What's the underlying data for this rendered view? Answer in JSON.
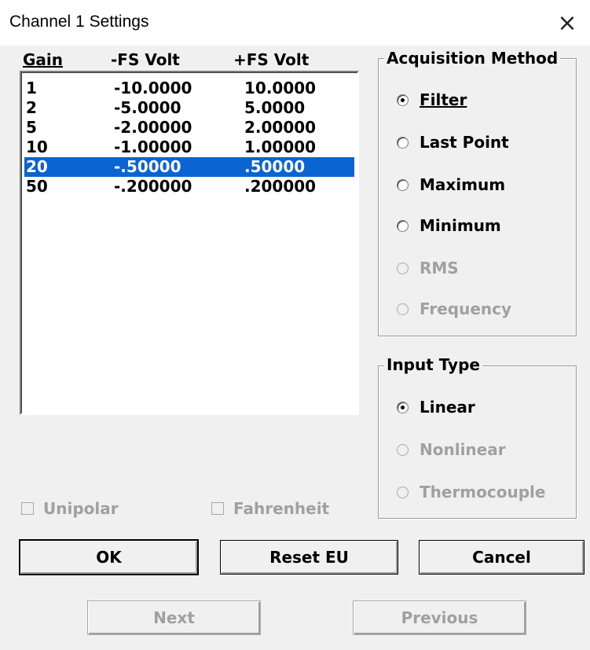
{
  "window": {
    "title": "Channel 1 Settings",
    "close": "×"
  },
  "list": {
    "headers": [
      "Gain",
      "-FS Volt",
      "+FS Volt"
    ],
    "rows": [
      [
        "1",
        "-10.0000",
        "10.0000"
      ],
      [
        "2",
        "-5.0000",
        "5.0000"
      ],
      [
        "5",
        "-2.00000",
        "2.00000"
      ],
      [
        "10",
        "-1.00000",
        "1.00000"
      ],
      [
        "20",
        "-.50000",
        ".50000"
      ],
      [
        "50",
        "-.200000",
        ".200000"
      ]
    ],
    "selected_index": 4
  },
  "acquisition": {
    "label": "Acquisition Method",
    "options": [
      "Filter",
      "Last Point",
      "Maximum",
      "Minimum",
      "RMS",
      "Frequency"
    ],
    "selected": "Filter",
    "disabled": [
      "RMS",
      "Frequency"
    ]
  },
  "input_type": {
    "label": "Input Type",
    "options": [
      "Linear",
      "Nonlinear",
      "Thermocouple"
    ],
    "selected": "Linear",
    "disabled": [
      "Nonlinear",
      "Thermocouple"
    ]
  },
  "checks": {
    "unipolar": "Unipolar",
    "fahrenheit": "Fahrenheit"
  },
  "buttons": {
    "ok": "OK",
    "reset": "Reset EU",
    "cancel": "Cancel",
    "next": "Next",
    "previous": "Previous"
  },
  "colors": {
    "selection": "#0a64d2",
    "disabled_text": "#a0a0a0"
  }
}
